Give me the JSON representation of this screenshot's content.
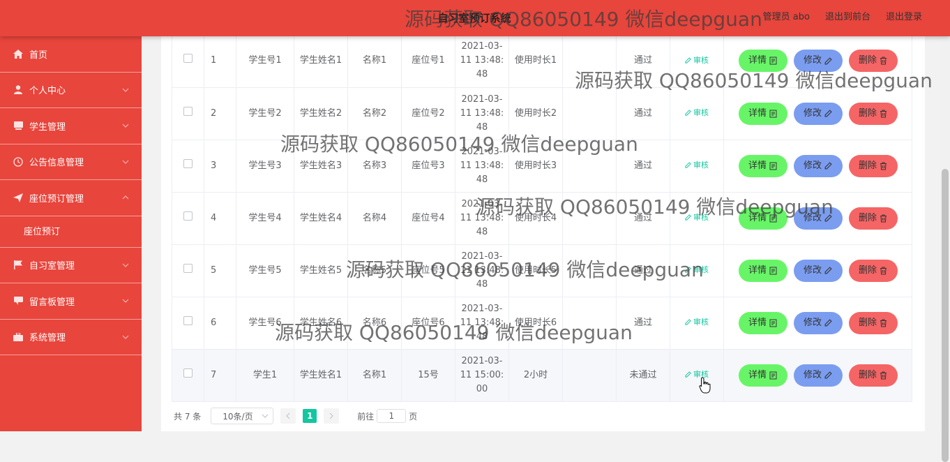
{
  "header": {
    "title": "自习室预订系统",
    "user_label": "管理员 abo",
    "to_front": "退出到前台",
    "logout": "退出登录"
  },
  "sidebar": {
    "items": [
      {
        "label": "首页",
        "icon": "home-icon"
      },
      {
        "label": "个人中心",
        "icon": "user-icon"
      },
      {
        "label": "学生管理",
        "icon": "book-icon"
      },
      {
        "label": "公告信息管理",
        "icon": "clock-icon"
      },
      {
        "label": "座位预订管理",
        "icon": "send-icon",
        "sub": "座位预订"
      },
      {
        "label": "自习室管理",
        "icon": "flag-icon"
      },
      {
        "label": "留言板管理",
        "icon": "chat-icon"
      },
      {
        "label": "系统管理",
        "icon": "briefcase-icon"
      }
    ]
  },
  "table": {
    "rows": [
      {
        "idx": "1",
        "sno": "学生号1",
        "sname": "学生姓名1",
        "name": "名称1",
        "seat": "座位号1",
        "time": "2021-03-11 13:48:48",
        "dur": "使用时长1",
        "remark": "",
        "status": "通过"
      },
      {
        "idx": "2",
        "sno": "学生号2",
        "sname": "学生姓名2",
        "name": "名称2",
        "seat": "座位号2",
        "time": "2021-03-11 13:48:48",
        "dur": "使用时长2",
        "remark": "",
        "status": "通过"
      },
      {
        "idx": "3",
        "sno": "学生号3",
        "sname": "学生姓名3",
        "name": "名称3",
        "seat": "座位号3",
        "time": "2021-03-11 13:48:48",
        "dur": "使用时长3",
        "remark": "",
        "status": "通过"
      },
      {
        "idx": "4",
        "sno": "学生号4",
        "sname": "学生姓名4",
        "name": "名称4",
        "seat": "座位号4",
        "time": "2021-03-11 13:48:48",
        "dur": "使用时长4",
        "remark": "",
        "status": "通过"
      },
      {
        "idx": "5",
        "sno": "学生号5",
        "sname": "学生姓名5",
        "name": "名称5",
        "seat": "座位号5",
        "time": "2021-03-11 13:48:48",
        "dur": "使用时长5",
        "remark": "",
        "status": "通过"
      },
      {
        "idx": "6",
        "sno": "学生号6",
        "sname": "学生姓名6",
        "name": "名称6",
        "seat": "座位号6",
        "time": "2021-03-11 13:48:48",
        "dur": "使用时长6",
        "remark": "",
        "status": "通过"
      },
      {
        "idx": "7",
        "sno": "学生1",
        "sname": "学生姓名1",
        "name": "名称1",
        "seat": "15号",
        "time": "2021-03-11 15:00:00",
        "dur": "2小时",
        "remark": "",
        "status": "未通过"
      }
    ],
    "audit_label": "审核",
    "detail_label": "详情",
    "edit_label": "修改",
    "delete_label": "删除"
  },
  "pager": {
    "total": "共 7 条",
    "page_size": "10条/页",
    "current": "1",
    "goto_prefix": "前往",
    "goto_value": "1",
    "goto_suffix": "页"
  },
  "watermark": "源码获取 QQ86050149 微信deepguan",
  "colors": {
    "accent": "#e8453c",
    "green": "#67f567",
    "blue": "#7b9df0",
    "red": "#f56565",
    "teal": "#13c6a0"
  }
}
